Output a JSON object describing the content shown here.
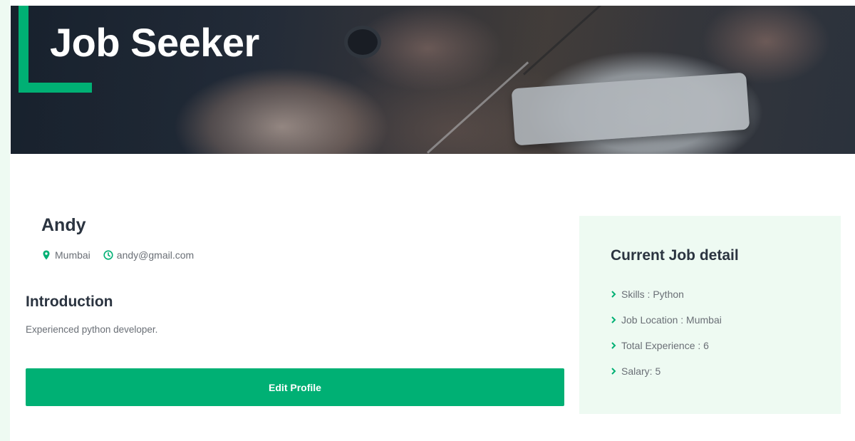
{
  "banner": {
    "title": "Job Seeker"
  },
  "profile": {
    "name": "Andy",
    "location": "Mumbai",
    "email": "andy@gmail.com"
  },
  "introduction": {
    "heading": "Introduction",
    "text": "Experienced python developer."
  },
  "actions": {
    "edit_profile_label": "Edit Profile"
  },
  "job_detail": {
    "title": "Current Job detail",
    "items": [
      {
        "label": "Skills : Python"
      },
      {
        "label": "Job Location : Mumbai"
      },
      {
        "label": "Total Experience : 6"
      },
      {
        "label": "Salary: 5"
      }
    ]
  },
  "colors": {
    "accent": "#00b074",
    "card_background": "#eefaf2",
    "heading": "#2b3440",
    "muted_text": "#6a6f76"
  },
  "icons": {
    "location": "map-pin-icon",
    "email": "clock-icon",
    "list_bullet": "chevron-right-icon"
  }
}
